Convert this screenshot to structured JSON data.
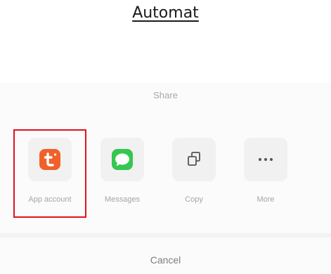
{
  "heading": "Automat",
  "share_sheet": {
    "title": "Share",
    "items": [
      {
        "label": "App account",
        "icon": "app-logo-icon",
        "color": "#f2602a",
        "highlighted": true
      },
      {
        "label": "Messages",
        "icon": "messages-icon",
        "color": "#35c750"
      },
      {
        "label": "Copy",
        "icon": "copy-icon"
      },
      {
        "label": "More",
        "icon": "more-dots-icon"
      }
    ],
    "cancel_label": "Cancel",
    "highlight_color": "#e0121d"
  }
}
